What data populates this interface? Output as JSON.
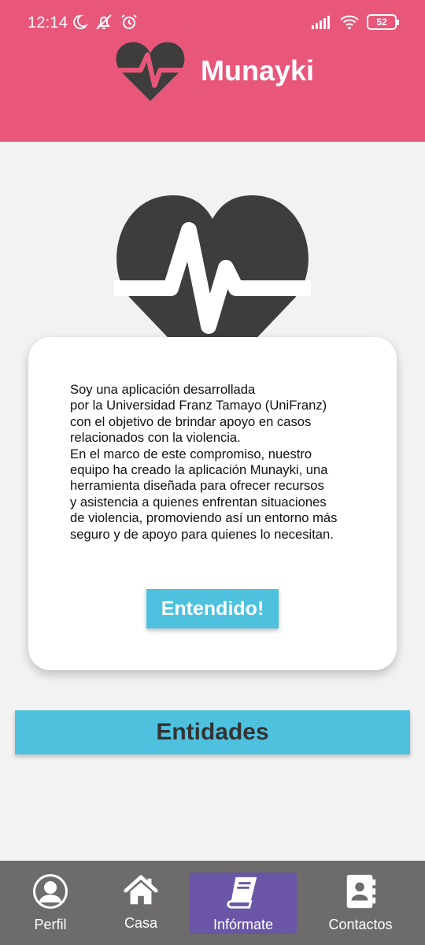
{
  "status": {
    "time": "12:14",
    "battery": "52"
  },
  "app": {
    "title": "Munayki"
  },
  "card": {
    "text": "Soy una aplicación desarrollada\npor la Universidad Franz Tamayo (UniFranz)\ncon el objetivo de brindar apoyo en casos\nrelacionados con la violencia.\nEn el marco de este compromiso, nuestro\nequipo ha creado la aplicación Munayki, una\nherramienta diseñada para ofrecer recursos\ny asistencia a quienes enfrentan situaciones\nde violencia, promoviendo así un entorno más\nseguro y de apoyo para quienes lo necesitan.",
    "button_label": "Entendido!"
  },
  "entities_button": "Entidades",
  "nav": [
    {
      "label": "Perfil",
      "icon": "user-icon"
    },
    {
      "label": "Casa",
      "icon": "home-icon"
    },
    {
      "label": "Infórmate",
      "icon": "book-icon",
      "active": true
    },
    {
      "label": "Contactos",
      "icon": "contacts-icon"
    }
  ],
  "colors": {
    "header": "#e8577a",
    "accent": "#4ec1df",
    "nav": "#6d6b6c",
    "nav_active": "#6b55a6",
    "heart": "#3d3d3d"
  }
}
